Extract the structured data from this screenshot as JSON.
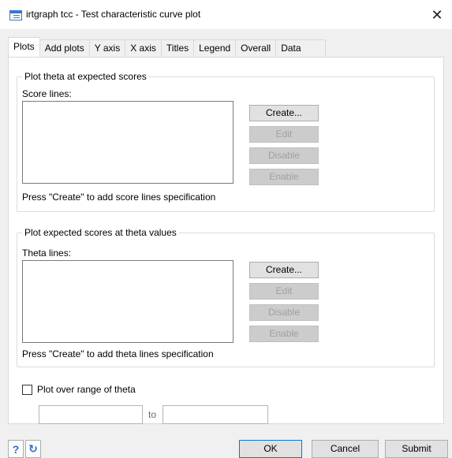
{
  "window": {
    "title": "irtgraph tcc - Test characteristic curve plot",
    "close_glyph": "✕"
  },
  "tabs": [
    {
      "label": "Plots",
      "active": true
    },
    {
      "label": "Add plots"
    },
    {
      "label": "Y axis"
    },
    {
      "label": "X axis"
    },
    {
      "label": "Titles"
    },
    {
      "label": "Legend"
    },
    {
      "label": "Overall"
    },
    {
      "label": "Data"
    }
  ],
  "score_group": {
    "legend": "Plot theta at expected scores",
    "list_label": "Score lines:",
    "hint": "Press \"Create\" to add score lines specification",
    "buttons": {
      "create": "Create...",
      "edit": "Edit",
      "disable": "Disable",
      "enable": "Enable"
    }
  },
  "theta_group": {
    "legend": "Plot expected scores at theta values",
    "list_label": "Theta lines:",
    "hint": "Press \"Create\" to add theta lines specification",
    "buttons": {
      "create": "Create...",
      "edit": "Edit",
      "disable": "Disable",
      "enable": "Enable"
    }
  },
  "range": {
    "checkbox_label": "Plot over range of theta",
    "checked": false,
    "from_value": "",
    "to_label": "to",
    "to_value": ""
  },
  "footer": {
    "help_icon": "?",
    "reset_icon": "↻",
    "ok": "OK",
    "cancel": "Cancel",
    "submit": "Submit"
  },
  "colors": {
    "accent": "#0078d7",
    "icon_blue": "#2f6fc4"
  }
}
